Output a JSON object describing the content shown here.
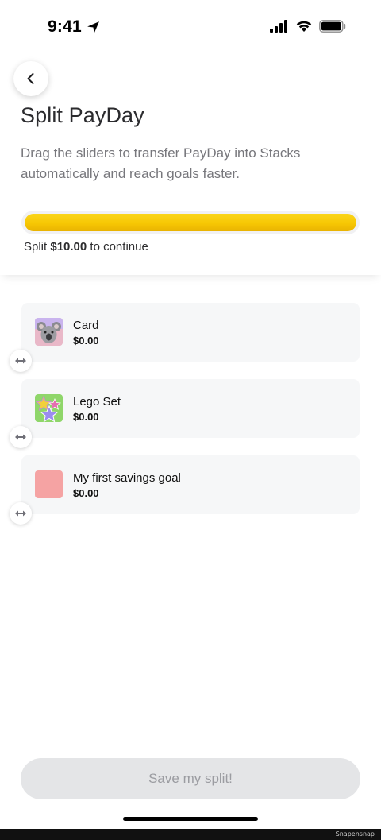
{
  "status_bar": {
    "time": "9:41",
    "location_icon": "location-arrow-icon",
    "icons": [
      "cellular-signal-icon",
      "wifi-icon",
      "battery-icon"
    ]
  },
  "header": {
    "back_icon": "chevron-left-icon",
    "title": "Split PayDay",
    "subtitle": "Drag the sliders to transfer PayDay into Stacks automatically and reach goals faster.",
    "progress_fraction": 1.0,
    "progress_color": "#f7c703",
    "hint_prefix": "Split ",
    "hint_amount": "$10.00",
    "hint_suffix": " to continue"
  },
  "goals": [
    {
      "name": "Card",
      "amount": "$0.00",
      "thumb": "koala-card-image"
    },
    {
      "name": "Lego Set",
      "amount": "$0.00",
      "thumb": "stars-image"
    },
    {
      "name": "My first savings goal",
      "amount": "$0.00",
      "thumb": "pink-swatch",
      "thumb_color": "#f5a3a3"
    }
  ],
  "drag_handle_icon": "drag-arrows-icon",
  "footer": {
    "save_label": "Save my split!"
  },
  "watermark": "Snapensnap"
}
